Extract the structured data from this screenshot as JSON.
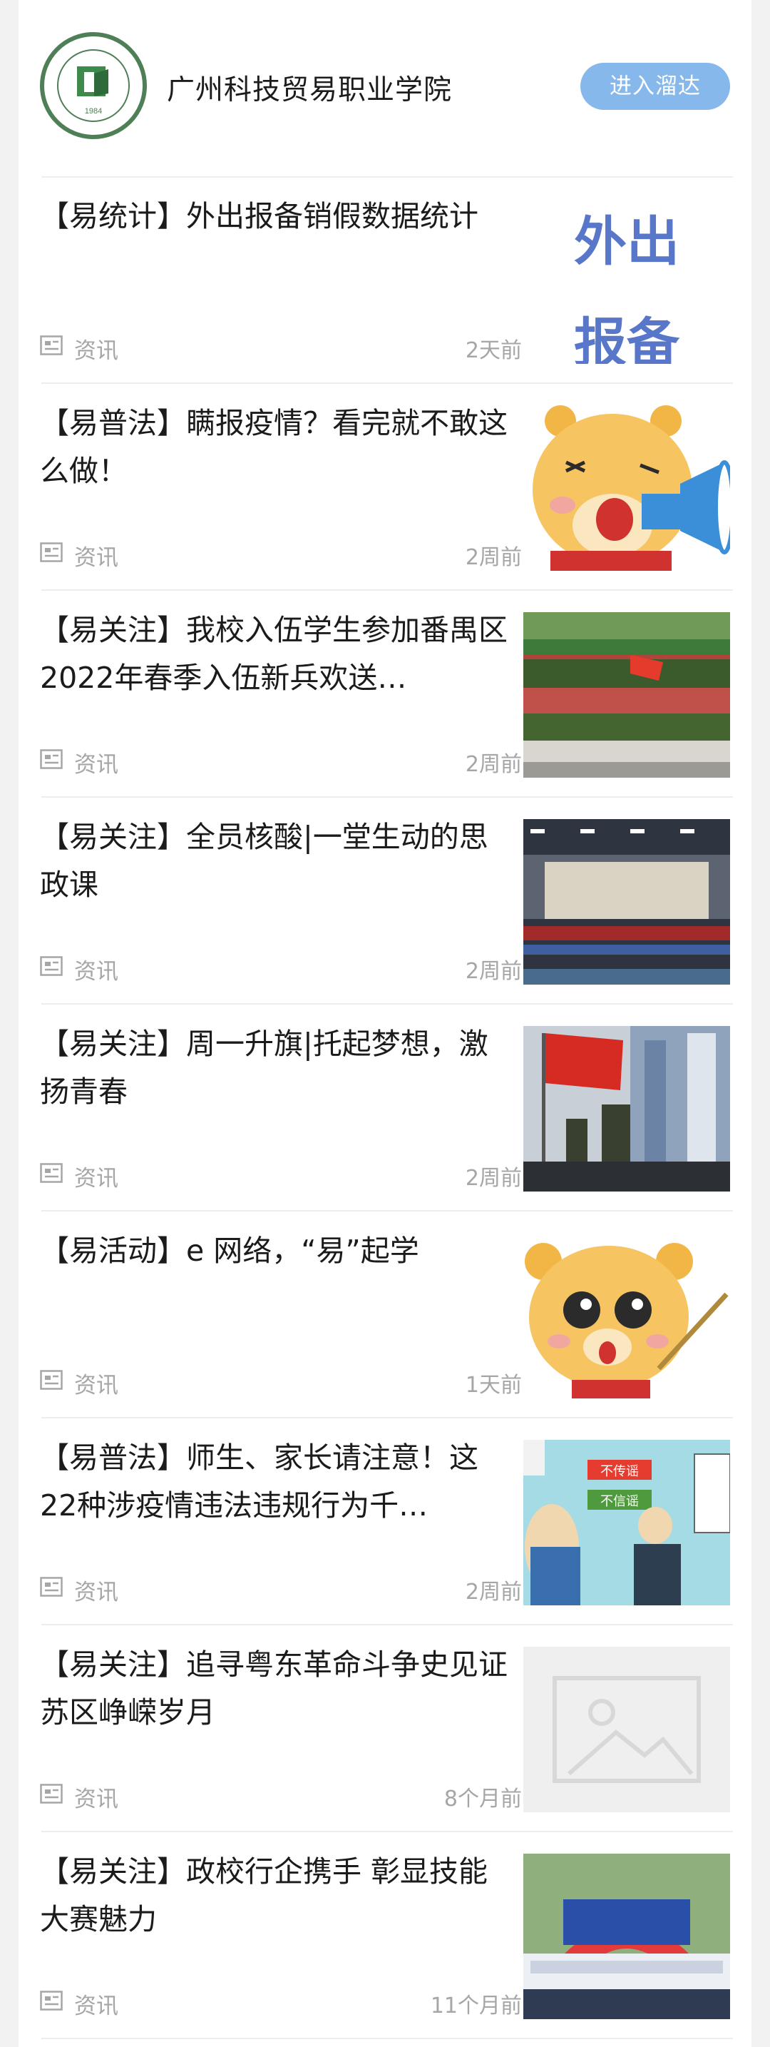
{
  "header": {
    "school_name": "广州科技贸易职业学院",
    "enter_button": "进入溜达",
    "logo_year": "1984"
  },
  "articles": [
    {
      "title": "【易统计】外出报备销假数据统计",
      "category": "资讯",
      "time": "2天前",
      "thumbnail": "text-graphic-外出报备",
      "thumb_text_1": "外出",
      "thumb_text_2": "报备"
    },
    {
      "title": "【易普法】瞒报疫情？看完就不敢这么做！",
      "category": "资讯",
      "time": "2周前",
      "thumbnail": "bear-megaphone-icon"
    },
    {
      "title": "【易关注】我校入伍学生参加番禺区2022年春季入伍新兵欢送…",
      "category": "资讯",
      "time": "2周前",
      "thumbnail": "group-photo-soldiers"
    },
    {
      "title": "【易关注】全员核酸|一堂生动的思政课",
      "category": "资讯",
      "time": "2周前",
      "thumbnail": "group-photo-hall"
    },
    {
      "title": "【易关注】周一升旗|托起梦想，激扬青春",
      "category": "资讯",
      "time": "2周前",
      "thumbnail": "flag-raising-photo"
    },
    {
      "title": "【易活动】e 网络，“易”起学",
      "category": "资讯",
      "time": "1天前",
      "thumbnail": "bear-pointer-icon"
    },
    {
      "title": "【易普法】师生、家长请注意！这22种涉疫情违法违规行为千…",
      "category": "资讯",
      "time": "2周前",
      "thumbnail": "rumor-cartoon",
      "thumb_text_1": "不传谣",
      "thumb_text_2": "不信谣"
    },
    {
      "title": "【易关注】追寻粤东革命斗争史见证苏区峥嵘岁月",
      "category": "资讯",
      "time": "8个月前",
      "thumbnail": "image-placeholder-icon"
    },
    {
      "title": "【易关注】政校行企携手 彰显技能大赛魅力",
      "category": "资讯",
      "time": "11个月前",
      "thumbnail": "competition-group-photo"
    }
  ],
  "colors": {
    "accent": "#87b8ec",
    "meta": "#a6a6a6",
    "text": "#1b1b1b"
  }
}
